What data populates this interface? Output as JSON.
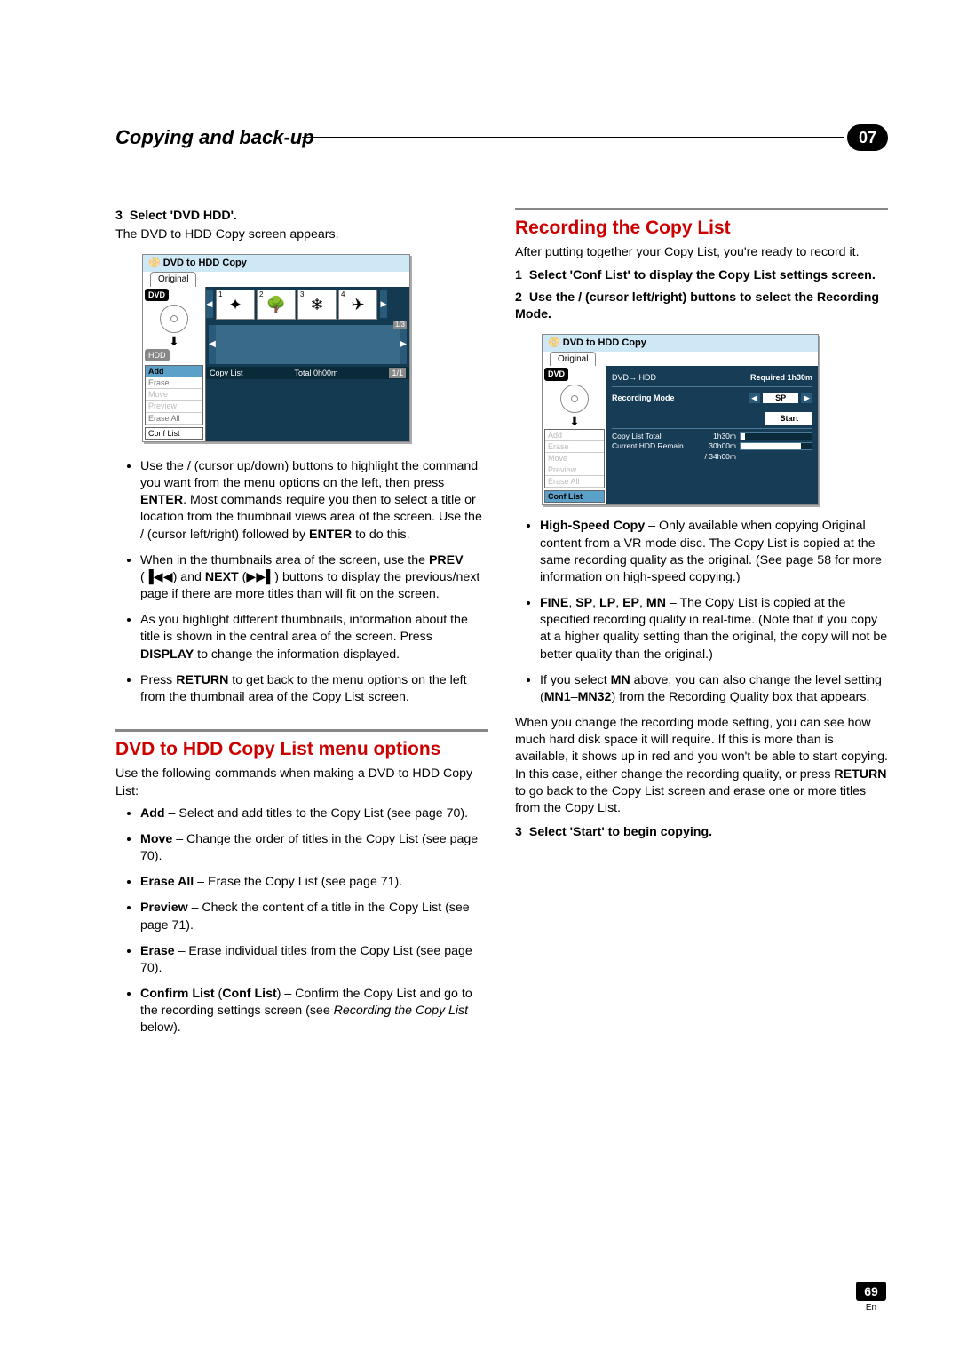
{
  "header": {
    "title": "Copying and back-up",
    "chapter": "07"
  },
  "left": {
    "step3": {
      "num": "3",
      "bold": "Select 'DVD     HDD'.",
      "after": "The DVD to HDD Copy screen appears."
    },
    "b1a": "Use the    /    (cursor up/down) buttons to highlight the command you want from the menu options on the left, then press ",
    "b1b": "ENTER",
    "b1c": ". Most commands require you then to select a title or location from the thumbnail views area of the screen. Use the    /    (cursor left/right) followed by ",
    "b1d": "ENTER",
    "b1e": " to do this.",
    "b2a": "When in the thumbnails area of the screen, use the ",
    "b2b": "PREV",
    "b2c": " (",
    "b2prev": "▐◀◀",
    "b2d": ") and ",
    "b2e": "NEXT",
    "b2f": " (",
    "b2next": "▶▶▌",
    "b2g": ") buttons to display the previous/next page if there are more titles than will fit on the screen.",
    "b3a": "As you highlight different thumbnails, information about the title is shown in the central area of the screen. Press ",
    "b3b": "DISPLAY",
    "b3c": " to change the information displayed.",
    "b4a": "Press ",
    "b4b": "RETURN",
    "b4c": " to get back to the menu options on the left from the thumbnail area of the Copy List screen.",
    "sec2_head": "DVD to HDD Copy List menu options",
    "sec2_intro": "Use the following commands when making a DVD to HDD Copy List:",
    "m1a": "Add",
    "m1b": " – Select and add titles to the Copy List (see page 70).",
    "m2a": "Move",
    "m2b": " – Change the order of titles in the Copy List (see page 70).",
    "m3a": "Erase All",
    "m3b": " – Erase the Copy List (see page 71).",
    "m4a": "Preview",
    "m4b": " – Check the content of a title in the Copy List (see page 71).",
    "m5a": "Erase",
    "m5b": " – Erase individual titles from the Copy List (see page 70).",
    "m6a": "Confirm List",
    "m6b": " (",
    "m6c": "Conf List",
    "m6d": ") – Confirm the Copy List and go to the recording settings screen (see ",
    "m6e": "Recording the Copy List",
    "m6f": " below)."
  },
  "right": {
    "sec_head": "Recording the Copy List",
    "intro": "After putting together your Copy List, you're ready to record it.",
    "s1": {
      "num": "1",
      "text": "Select 'Conf List' to display the Copy List settings screen."
    },
    "s2": {
      "num": "2",
      "text": "Use the    /    (cursor left/right) buttons to select the Recording Mode."
    },
    "r1a": "High-Speed Copy",
    "r1b": " – Only available when copying Original content from a VR mode disc. The Copy List is copied at the same recording quality as the original. (See page 58 for more information on high-speed copying.)",
    "r2a": "FINE",
    "r2b": ", ",
    "r2c": "SP",
    "r2d": ", ",
    "r2e": "LP",
    "r2f": ", ",
    "r2g": "EP",
    "r2h": ", ",
    "r2i": "MN",
    "r2j": " – The Copy List is copied at the specified recording quality in real-time. (Note that if you copy at a higher quality setting than the original, the copy will not be better quality than the original.)",
    "r3a": "If you select ",
    "r3b": "MN",
    "r3c": " above, you can also change the level setting (",
    "r3d": "MN1",
    "r3e": "–",
    "r3f": "MN32",
    "r3g": ") from the Recording Quality box that appears.",
    "para_a": "When you change the recording mode setting, you can see how much hard disk space it will require. If this is more than is available, it shows up in red and you won't be able to start copying. In this case, either change the recording quality, or press ",
    "para_b": "RETURN",
    "para_c": " to go back to the Copy List screen and erase one or more titles from the Copy List.",
    "s3": {
      "num": "3",
      "text": "Select 'Start' to begin copying."
    }
  },
  "ui1": {
    "title": "DVD to HDD Copy",
    "tab": "Original",
    "dvd": "DVD",
    "hdd": "HDD",
    "menu": {
      "add": "Add",
      "erase": "Erase",
      "move": "Move",
      "preview": "Preview",
      "eraseall": "Erase All",
      "conf": "Conf List"
    },
    "t1": "1",
    "t2": "2",
    "t3": "3",
    "t4": "4",
    "pg": "1/3",
    "copylist": "Copy List",
    "total": "Total  0h00m",
    "ftab": "1/1"
  },
  "ui2": {
    "title": "DVD to HDD Copy",
    "tab": "Original",
    "dvd": "DVD",
    "menu": {
      "add": "Add",
      "erase": "Erase",
      "move": "Move",
      "preview": "Preview",
      "eraseall": "Erase All",
      "conf": "Conf List"
    },
    "dir": "DVD→ HDD",
    "req": "Required 1h30m",
    "rec": "Recording Mode",
    "sp": "SP",
    "start": "Start",
    "clt": "Copy List Total",
    "cltv": "1h30m",
    "chr": "Current HDD Remain",
    "chrv": "30h00m",
    "chrv2": "/ 34h00m"
  },
  "footer": {
    "page": "69",
    "lang": "En"
  }
}
